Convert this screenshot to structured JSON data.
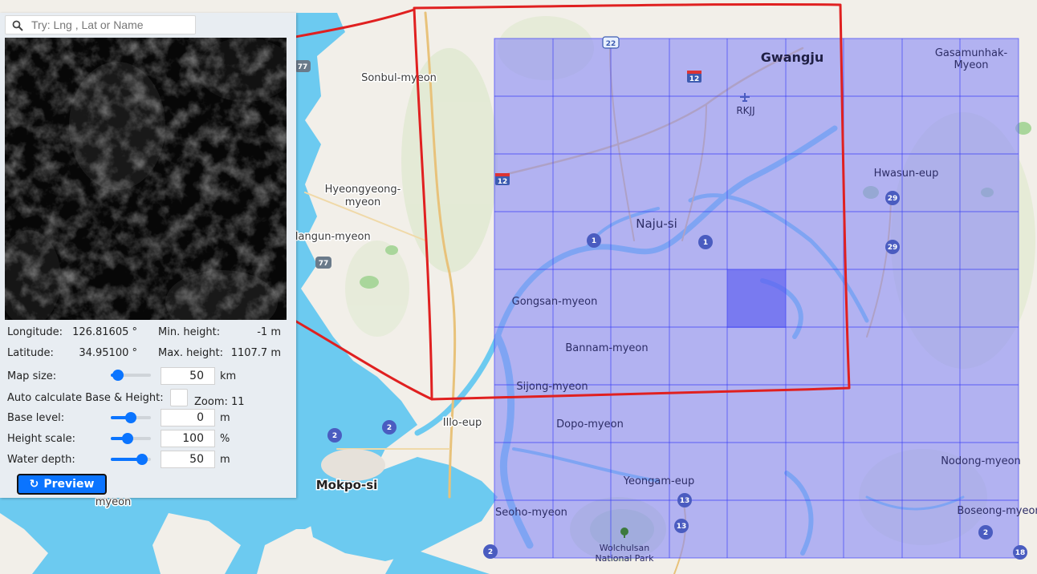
{
  "search": {
    "placeholder": "Try: Lng , Lat or Name"
  },
  "info": {
    "longitude_label": "Longitude:",
    "longitude_value": "126.81605 °",
    "latitude_label": "Latitude:",
    "latitude_value": "34.95100 °",
    "min_height_label": "Min. height:",
    "min_height_value": "-1 m",
    "max_height_label": "Max. height:",
    "max_height_value": "1107.7 m"
  },
  "controls": {
    "map_size": {
      "label": "Map size:",
      "value": "50",
      "unit": "km",
      "slider_fraction": 0.18
    },
    "auto_calc": {
      "label": "Auto calculate Base & Height:",
      "checked": false
    },
    "zoom": "Zoom: 11",
    "base_level": {
      "label": "Base level:",
      "value": "0",
      "unit": "m",
      "slider_fraction": 0.5
    },
    "height_scale": {
      "label": "Height scale:",
      "value": "100",
      "unit": "%",
      "slider_fraction": 0.42
    },
    "water_depth": {
      "label": "Water depth:",
      "value": "50",
      "unit": "m",
      "slider_fraction": 0.78
    }
  },
  "preview_button": {
    "label": "Preview"
  },
  "map": {
    "places": {
      "gwangju": "Gwangju",
      "gasamunhak": "Gasamunhak-",
      "gasamunhak_2": "Myeon",
      "sonbul": "Sonbul-myeon",
      "rkjj": "RKJJ",
      "hyeongyeong": "Hyeongyeong-",
      "hyeongyeong_2": "myeon",
      "hwasun": "Hwasun-eup",
      "naju": "Naju-si",
      "mangun": "Mangun-myeon",
      "gongsan": "Gongsan-myeon",
      "bannam": "Bannam-myeon",
      "sijong": "Sijong-myeon",
      "illo": "Illo-eup",
      "dopo": "Dopo-myeon",
      "nodong": "Nodong-myeon",
      "mokpo": "Mokpo-si",
      "yeongam": "Yeongam-eup",
      "myeon_partial": "myeon",
      "seoho": "Seoho-myeon",
      "boseong": "Boseong-myeon",
      "wolchulsan": "Wolchulsan",
      "national_park": "National Park"
    },
    "shields": {
      "s22": "22",
      "s12a": "12",
      "s12b": "12",
      "s77a": "77",
      "s77b": "77",
      "s1a": "1",
      "s1b": "1",
      "s29a": "29",
      "s29b": "29",
      "s2a": "2",
      "s2b": "2",
      "s2c": "2",
      "s2d": "2",
      "s13a": "13",
      "s13b": "13",
      "s18": "18"
    },
    "colors": {
      "water": "#6ccaf0",
      "land": "#f2efe9",
      "selection_fill": "#8a8cf5",
      "grid_line": "#3b3ff5",
      "highlight_cell": "#5a5cf0",
      "annotation": "#e02020"
    }
  }
}
